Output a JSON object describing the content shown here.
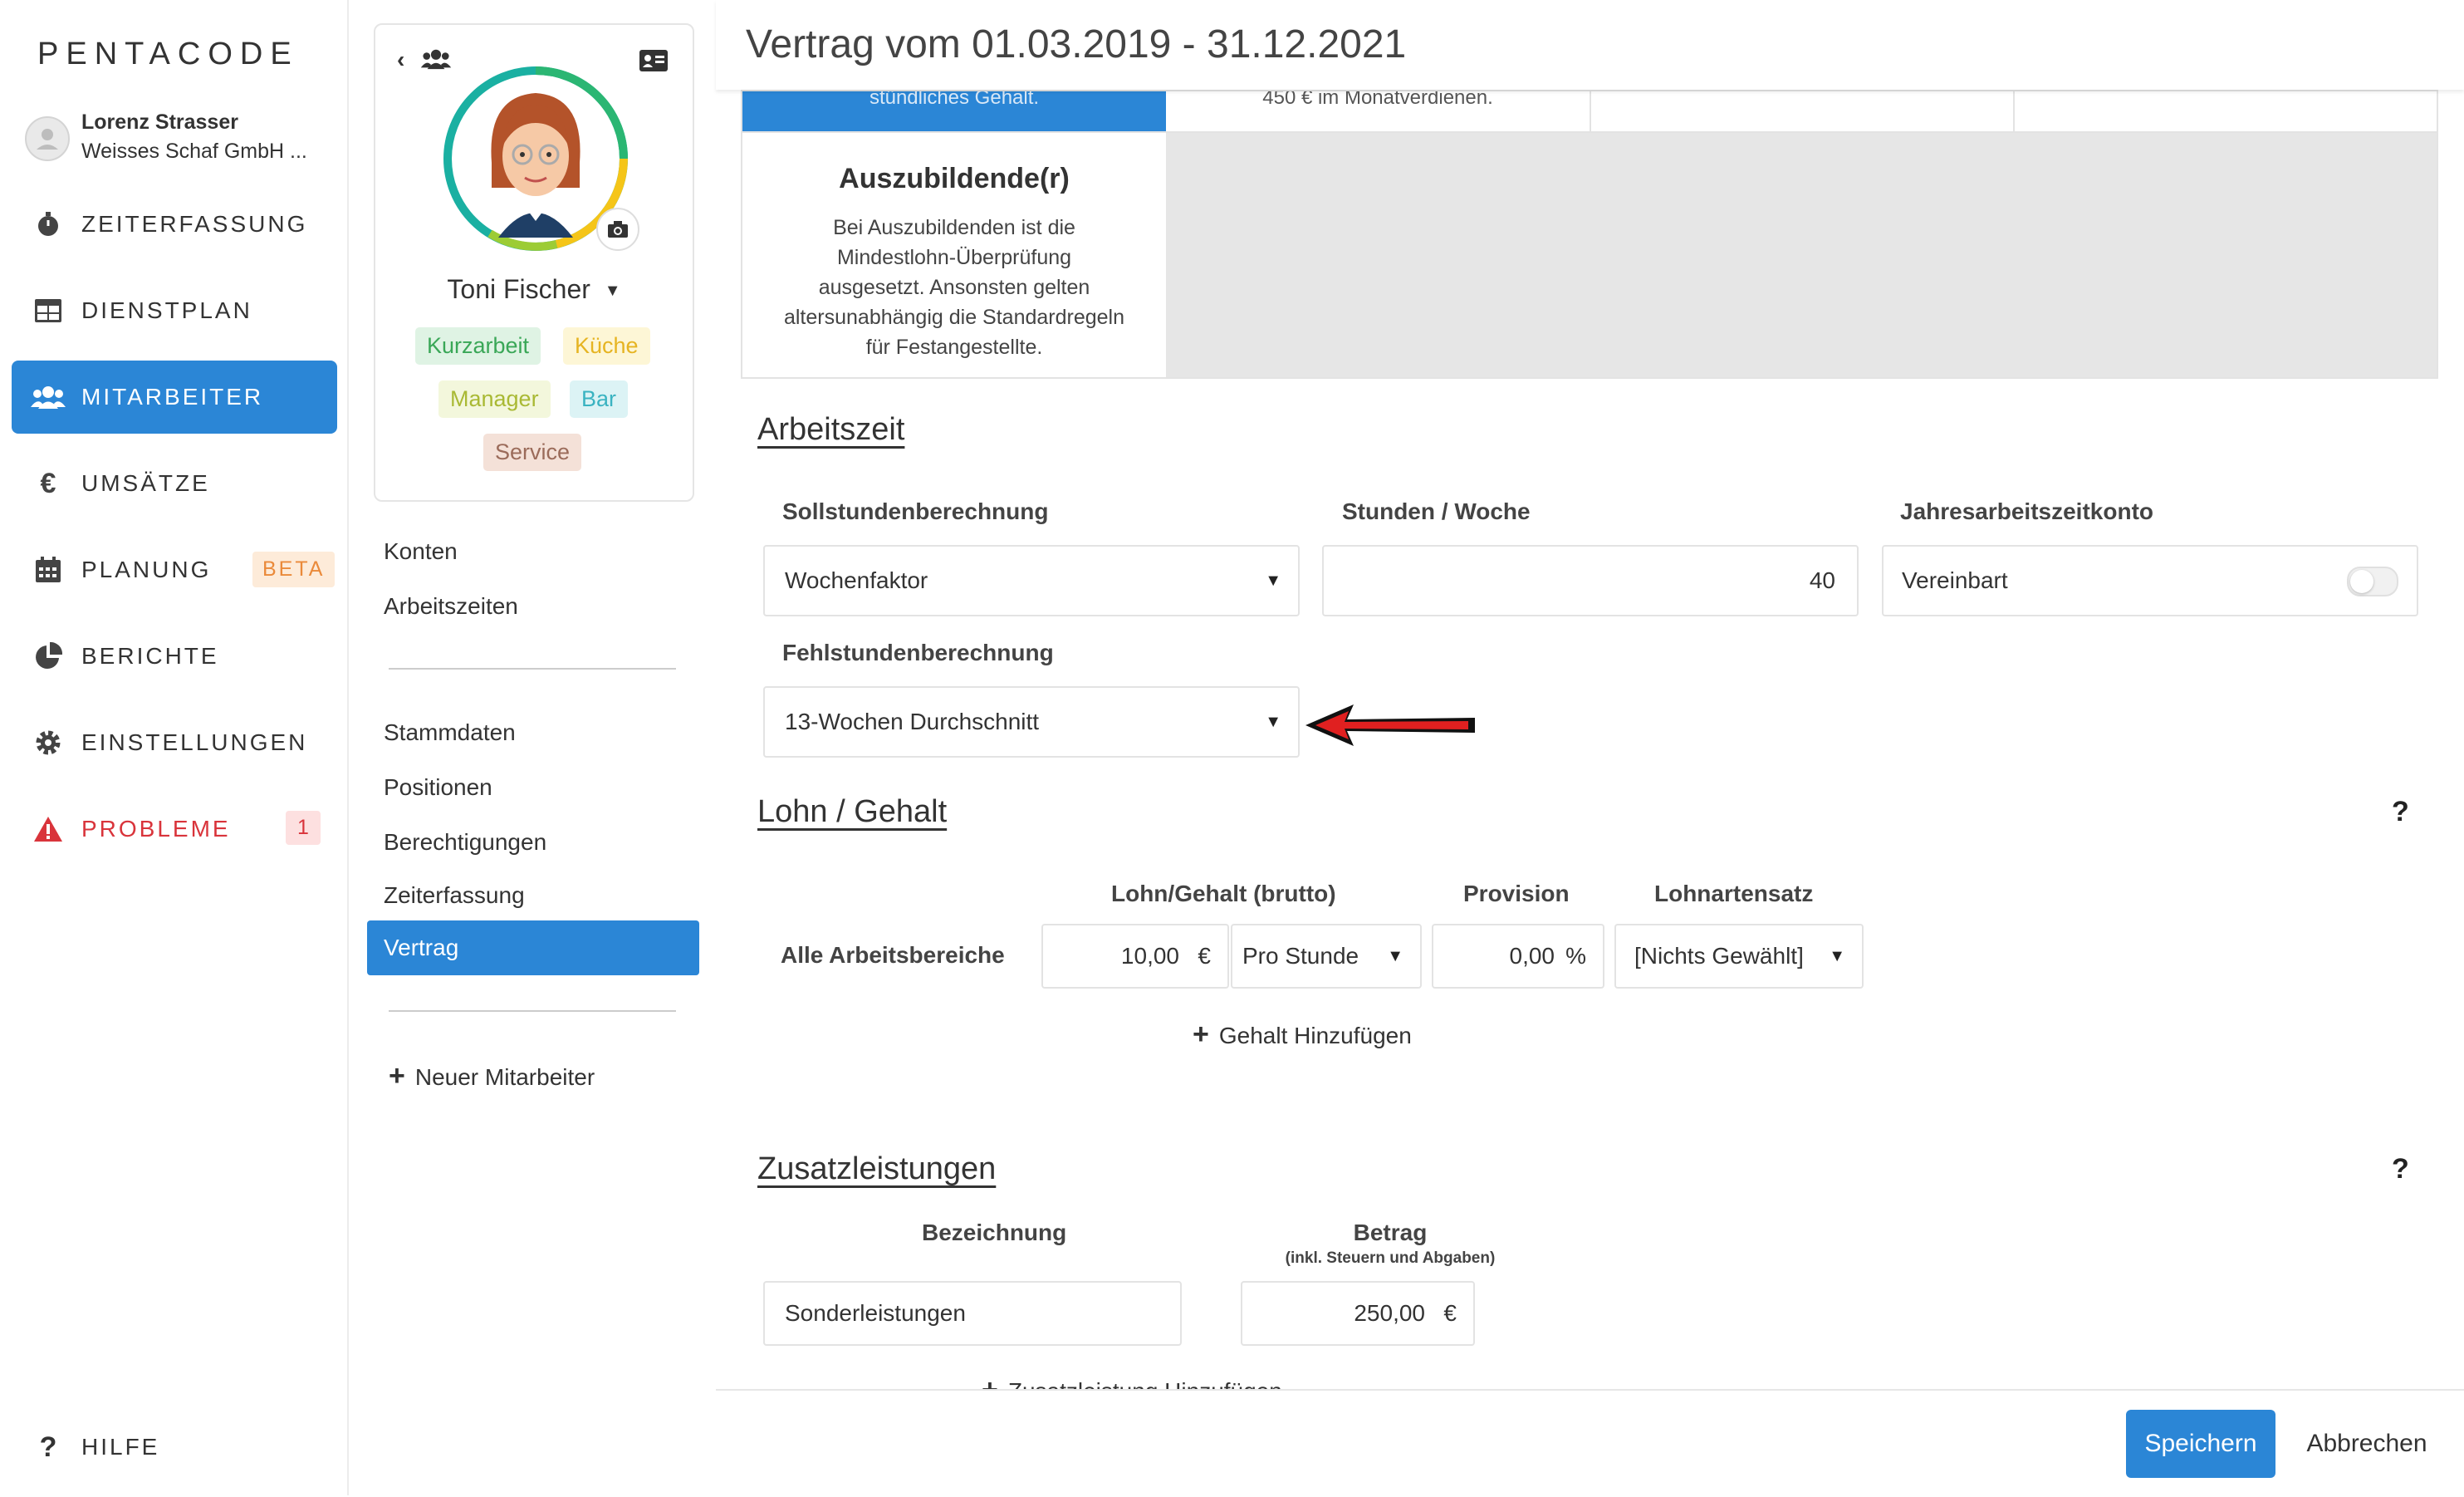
{
  "app": {
    "logo": "PENTACODE"
  },
  "user": {
    "name": "Lorenz Strasser",
    "company": "Weisses Schaf GmbH ..."
  },
  "nav": {
    "items": [
      {
        "label": "ZEITERFASSUNG",
        "icon": "stopwatch-icon"
      },
      {
        "label": "DIENSTPLAN",
        "icon": "table-icon"
      },
      {
        "label": "MITARBEITER",
        "icon": "users-icon",
        "active": true
      },
      {
        "label": "UMSÄTZE",
        "icon": "euro-icon"
      },
      {
        "label": "PLANUNG",
        "icon": "calendar-icon",
        "badge": "BETA"
      },
      {
        "label": "BERICHTE",
        "icon": "pie-chart-icon"
      },
      {
        "label": "EINSTELLUNGEN",
        "icon": "gear-icon"
      },
      {
        "label": "PROBLEME",
        "icon": "warning-icon",
        "count": "1"
      }
    ],
    "help": "HILFE"
  },
  "employee": {
    "name": "Toni Fischer",
    "tags": [
      {
        "label": "Kurzarbeit",
        "bg": "#dff3e4",
        "fg": "#3aa757"
      },
      {
        "label": "Küche",
        "bg": "#fdf6d6",
        "fg": "#e6b422"
      },
      {
        "label": "Manager",
        "bg": "#f3f7dc",
        "fg": "#a9b934"
      },
      {
        "label": "Bar",
        "bg": "#dcf3f5",
        "fg": "#3ab3c1"
      },
      {
        "label": "Service",
        "bg": "#f4e1d8",
        "fg": "#9b6b5a"
      }
    ],
    "links_top": [
      "Konten",
      "Arbeitszeiten"
    ],
    "links_main": [
      "Stammdaten",
      "Positionen",
      "Berechtigungen",
      "Zeiterfassung",
      "Vertrag"
    ],
    "new_employee": "Neuer Mitarbeiter"
  },
  "main": {
    "title": "Vertrag vom 01.03.2019 - 31.12.2021",
    "cut_top_left": "stündliches Gehalt.",
    "cut_top_right": "450 € im Monatverdienen.",
    "apprentice": {
      "title": "Auszubildende(r)",
      "lines": [
        "Bei Auszubildenden ist die",
        "Mindestlohn-Überprüfung",
        "ausgesetzt. Ansonsten gelten",
        "altersunabhängig die Standardregeln",
        "für Festangestellte."
      ]
    },
    "arbeitszeit": {
      "title": "Arbeitszeit",
      "soll_label": "Sollstundenberechnung",
      "soll_value": "Wochenfaktor",
      "stunden_label": "Stunden / Woche",
      "stunden_value": "40",
      "jahres_label": "Jahresarbeitszeitkonto",
      "jahres_value": "Vereinbart",
      "fehl_label": "Fehlstundenberechnung",
      "fehl_value": "13-Wochen Durchschnitt"
    },
    "lohn": {
      "title": "Lohn / Gehalt",
      "help": "?",
      "col_lohn": "Lohn/Gehalt (brutto)",
      "col_provision": "Provision",
      "col_lohnart": "Lohnartensatz",
      "row_label": "Alle Arbeitsbereiche",
      "amount": "10,00",
      "currency": "€",
      "period": "Pro Stunde",
      "provision": "0,00",
      "percent": "%",
      "lohnart": "[Nichts Gewählt]",
      "add": "Gehalt Hinzufügen"
    },
    "zusatz": {
      "title": "Zusatzleistungen",
      "help": "?",
      "col_bez": "Bezeichnung",
      "col_betrag": "Betrag",
      "col_betrag_sub": "(inkl. Steuern und Abgaben)",
      "bez_value": "Sonderleistungen",
      "betrag_value": "250,00",
      "currency": "€",
      "add": "Zusatzleistung Hinzufügen"
    },
    "footer": {
      "save": "Speichern",
      "cancel": "Abbrechen"
    }
  }
}
